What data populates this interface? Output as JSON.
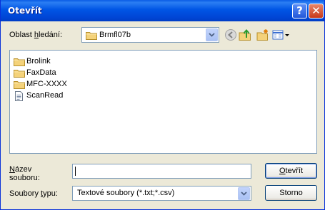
{
  "title": "Otevřít",
  "icons": {
    "help": "?",
    "close": "✕"
  },
  "lookin": {
    "label_pre": "Oblast ",
    "label_accel": "h",
    "label_post": "ledání:",
    "value": "Brmfl07b"
  },
  "files": [
    {
      "name": "Brolink",
      "type": "folder"
    },
    {
      "name": "FaxData",
      "type": "folder"
    },
    {
      "name": "MFC-XXXX",
      "type": "folder"
    },
    {
      "name": "ScanRead",
      "type": "file"
    }
  ],
  "filename": {
    "label_accel": "N",
    "label_line1_rest": "ázev",
    "label_line2": "souboru:",
    "value": ""
  },
  "filetype": {
    "label_pre": "Soubory ",
    "label_accel": "t",
    "label_post": "ypu:",
    "value": "Textové soubory (*.txt;*.csv)"
  },
  "buttons": {
    "open_accel": "O",
    "open_rest": "tevřít",
    "cancel": "Storno"
  },
  "colors": {
    "titlebar": "#0055e5",
    "dialog_bg": "#ece9d8",
    "border": "#7f9db9"
  }
}
